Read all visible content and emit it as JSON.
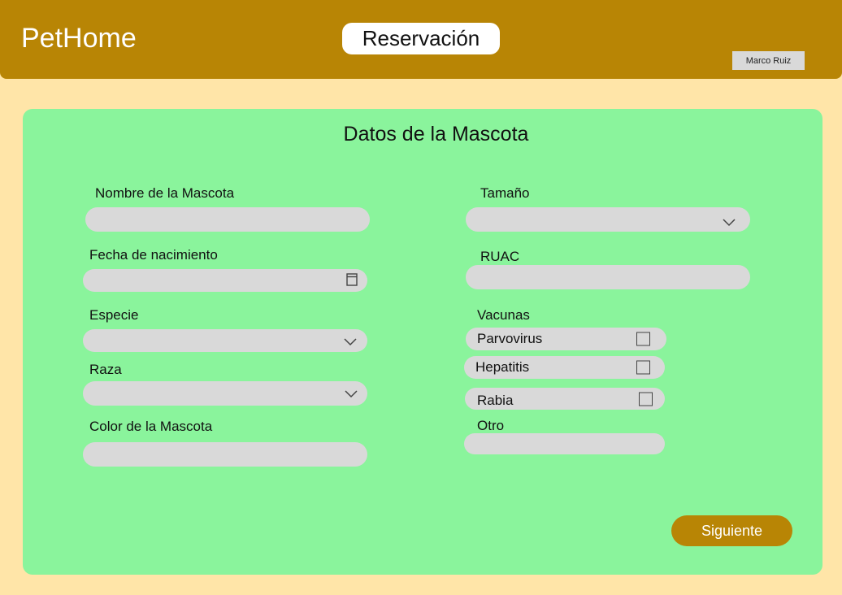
{
  "header": {
    "brand": "PetHome",
    "title": "Reservación",
    "user": "Marco Ruiz"
  },
  "form": {
    "title": "Datos de la Mascota",
    "left": {
      "pet_name_label": "Nombre de la Mascota",
      "pet_name_value": "",
      "birth_date_label": "Fecha de nacimiento",
      "birth_date_value": "",
      "species_label": "Especie",
      "species_value": "",
      "breed_label": "Raza",
      "breed_value": "",
      "color_label": "Color de la Mascota",
      "color_value": ""
    },
    "right": {
      "size_label": "Tamaño",
      "size_value": "",
      "ruac_label": "RUAC",
      "ruac_value": "",
      "vaccines_label": "Vacunas",
      "vaccines": [
        {
          "label": "Parvovirus",
          "checked": false
        },
        {
          "label": "Hepatitis",
          "checked": false
        },
        {
          "label": "Rabia",
          "checked": false
        }
      ],
      "other_label": "Otro",
      "other_value": ""
    },
    "next_button": "Siguiente"
  },
  "icons": {
    "dropdown": "chevron-down-icon",
    "date": "calendar-icon",
    "checkbox": "checkbox-icon"
  },
  "colors": {
    "header_bg": "#b88505",
    "page_bg": "#ffe5a8",
    "card_bg": "#8af49c",
    "field_bg": "#d9d9d9",
    "button_bg": "#b88505"
  }
}
